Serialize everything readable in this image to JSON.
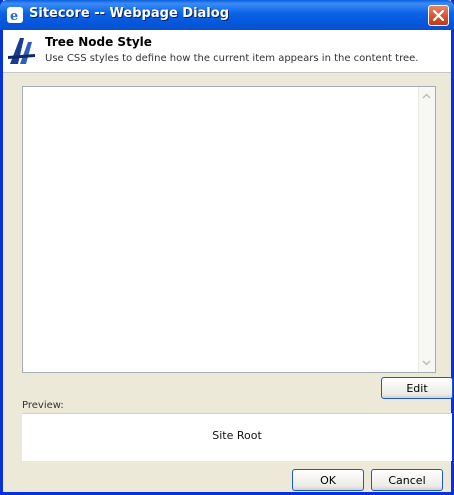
{
  "window": {
    "title": "Sitecore -- Webpage Dialog"
  },
  "header": {
    "title": "Tree Node Style",
    "subtitle": "Use CSS styles to define how the current item appears in the content tree."
  },
  "editor": {
    "value": ""
  },
  "buttons": {
    "edit": "Edit",
    "ok": "OK",
    "cancel": "Cancel"
  },
  "preview": {
    "label": "Preview:",
    "text": "Site Root"
  },
  "colors": {
    "titlebar": "#0a5fe0",
    "frame": "#0831d9",
    "close": "#d2502f",
    "button_border": "#1b5ac8"
  },
  "icons": {
    "app": "ie-icon",
    "close": "close-icon",
    "logo": "sitecore-logo-icon"
  }
}
